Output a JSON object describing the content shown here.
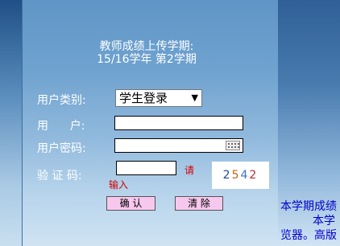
{
  "header": {
    "title_line1": "教师成绩上传学期:",
    "title_line2": "15/16学年 第2学期"
  },
  "form": {
    "user_type_label": "用户类别:",
    "user_type_value": "学生登录",
    "user_label": "用      户:",
    "password_label": "用户密码:",
    "captcha_label": "验 证 码:",
    "captcha_hint_part1": "请",
    "captcha_hint_part2": "输入",
    "captcha_digits": [
      "2",
      "5",
      "4",
      "2"
    ],
    "captcha_colors": [
      "#2d4a8a",
      "#c2661a",
      "#3b6fc8",
      "#b0303a"
    ],
    "confirm_label": "确 认",
    "clear_label": "清 除"
  },
  "side_notes": {
    "line1": "本学期成绩",
    "line2": "本学",
    "line3": "览器。高版"
  },
  "colors": {
    "button_bg": "#f7c8ee",
    "hint_red": "#d40000",
    "note_blue": "#0000cc"
  }
}
